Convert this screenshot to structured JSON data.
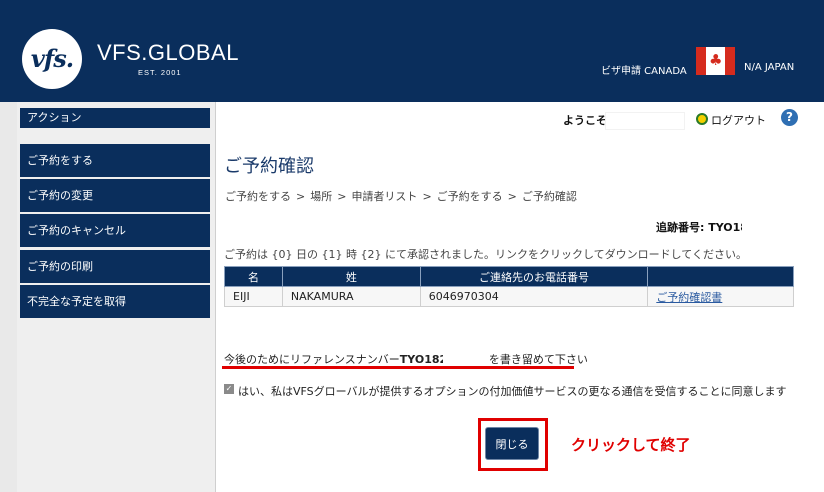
{
  "header": {
    "logo_text": "vfs.",
    "brand": "VFS.GLOBAL",
    "est": "EST. 2001",
    "visa_label": "ビザ申請 CANADA",
    "country": "N/A JAPAN",
    "flag_icon": "canada-flag-icon"
  },
  "sidebar": {
    "header": "アクション",
    "items": [
      {
        "label": "ご予約をする"
      },
      {
        "label": "ご予約の変更"
      },
      {
        "label": "ご予約のキャンセル"
      },
      {
        "label": "ご予約の印刷"
      },
      {
        "label": "不完全な予定を取得"
      }
    ]
  },
  "topbar": {
    "welcome": "ようこそ",
    "logout": "ログアウト",
    "help_glyph": "?"
  },
  "main": {
    "title": "ご予約確認",
    "breadcrumb": [
      "ご予約をする",
      "場所",
      "申請者リスト",
      "ご予約をする",
      "ご予約確認"
    ],
    "breadcrumb_sep": ">",
    "tracking": "追跡番号: TYO18",
    "notice": "ご予約は {0} 日の {1} 時 {2} にて承認されました。リンクをクリックしてダウンロードしてください。",
    "table": {
      "headers": [
        "名",
        "姓",
        "ご連絡先のお電話番号",
        ""
      ],
      "rows": [
        {
          "first": "EIJI",
          "last": "NAKAMURA",
          "phone": "6046970304",
          "link": "ご予約確認書"
        }
      ]
    },
    "ref_note_before": "今後のためにリファレンスナンバー",
    "ref_number": "TYO1823",
    "ref_note_after": "を書き留めて下さい",
    "consent": "はい、私はVFSグローバルが提供するオプションの付加価値サービスの更なる通信を受信することに同意します",
    "close_button": "閉じる",
    "annotation": "クリックして終了"
  },
  "colors": {
    "navy": "#0a2e5c",
    "annotation_red": "#e00000"
  }
}
